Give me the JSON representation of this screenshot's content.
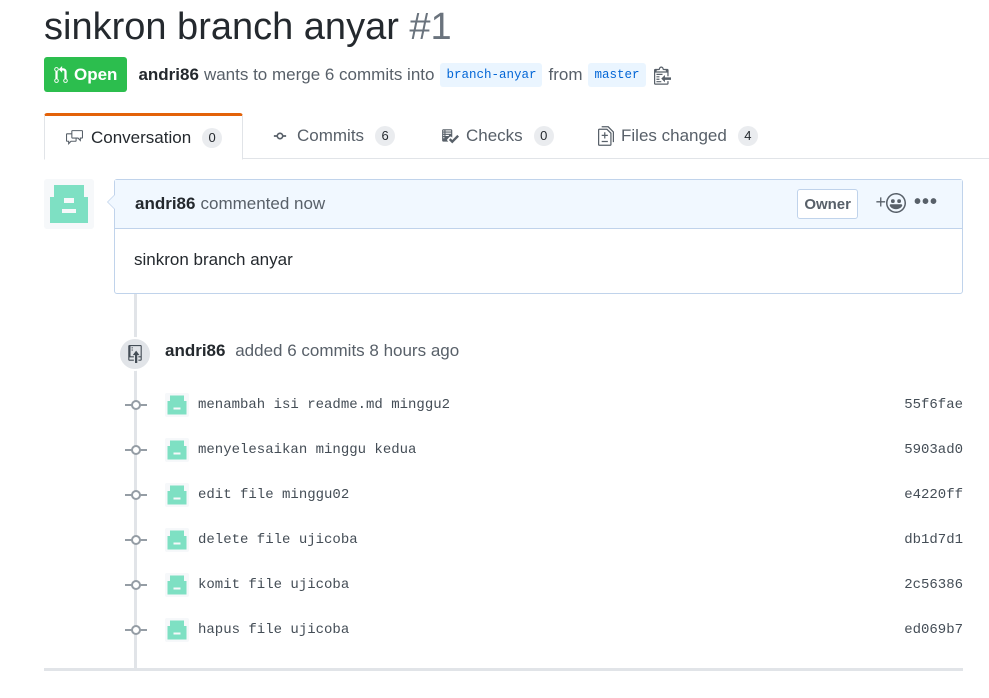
{
  "pr": {
    "title": "sinkron branch anyar",
    "number": "#1",
    "state": "Open",
    "author": "andri86",
    "meta_text": "wants to merge 6 commits into",
    "base_branch": "branch-anyar",
    "from_text": "from",
    "head_branch": "master"
  },
  "tabs": [
    {
      "label": "Conversation",
      "count": "0",
      "icon": "comment-discussion-icon"
    },
    {
      "label": "Commits",
      "count": "6",
      "icon": "git-commit-icon"
    },
    {
      "label": "Checks",
      "count": "0",
      "icon": "checklist-icon"
    },
    {
      "label": "Files changed",
      "count": "4",
      "icon": "file-diff-icon"
    }
  ],
  "comment": {
    "author": "andri86",
    "action": "commented now",
    "role_label": "Owner",
    "reaction_plus": "+",
    "more": "•••",
    "body": "sinkron branch anyar"
  },
  "event": {
    "author": "andri86",
    "text": "added 6 commits 8 hours ago"
  },
  "commits": [
    {
      "message": "menambah isi readme.md minggu2",
      "sha": "55f6fae"
    },
    {
      "message": "menyelesaikan minggu kedua",
      "sha": "5903ad0"
    },
    {
      "message": "edit file minggu02",
      "sha": "e4220ff"
    },
    {
      "message": "delete file ujicoba",
      "sha": "db1d7d1"
    },
    {
      "message": "komit file ujicoba",
      "sha": "2c56386"
    },
    {
      "message": "hapus file ujicoba",
      "sha": "ed069b7"
    }
  ],
  "colors": {
    "open_green": "#2cbe4e",
    "link_blue": "#0366d6",
    "avatar_teal": "#7ee0c3",
    "tab_accent": "#e36209"
  }
}
